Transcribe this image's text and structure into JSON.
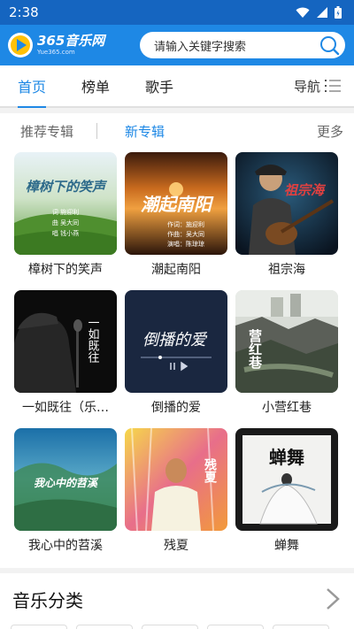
{
  "status": {
    "time": "2:38"
  },
  "app": {
    "logo_title": "365音乐网",
    "logo_sub": "Yue365.com"
  },
  "search": {
    "placeholder": "请输入关键字搜索"
  },
  "tabs": [
    {
      "label": "首页"
    },
    {
      "label": "榜单"
    },
    {
      "label": "歌手"
    }
  ],
  "nav_label": "导航",
  "subtabs": {
    "recommended": "推荐专辑",
    "new": "新专辑",
    "more": "更多"
  },
  "albums": [
    {
      "title": "樟树下的笑声",
      "cover_text": "樟树下的笑声",
      "credits": [
        "词 施迎利",
        "曲 吴大同",
        "唱 钱小燕"
      ]
    },
    {
      "title": "潮起南阳",
      "cover_text": "潮起南阳",
      "credits": [
        "作词：施迎利",
        "作曲：吴大同",
        "演唱：陈琼琼"
      ]
    },
    {
      "title": "祖宗海",
      "cover_text": "祖宗海"
    },
    {
      "title": "一如既往（乐…",
      "cover_text": "一如既往"
    },
    {
      "title": "倒播的爱",
      "cover_text": "倒播的爱"
    },
    {
      "title": "小营红巷",
      "cover_text": "营红巷"
    },
    {
      "title": "我心中的苕溪",
      "cover_text": "我心中的苕溪"
    },
    {
      "title": "残夏",
      "cover_text": "残夏"
    },
    {
      "title": "蝉舞",
      "cover_text": "蝉舞"
    }
  ],
  "category": {
    "title": "音乐分类"
  },
  "colors": {
    "primary": "#1e88e5",
    "status_bar": "#1565c0"
  }
}
